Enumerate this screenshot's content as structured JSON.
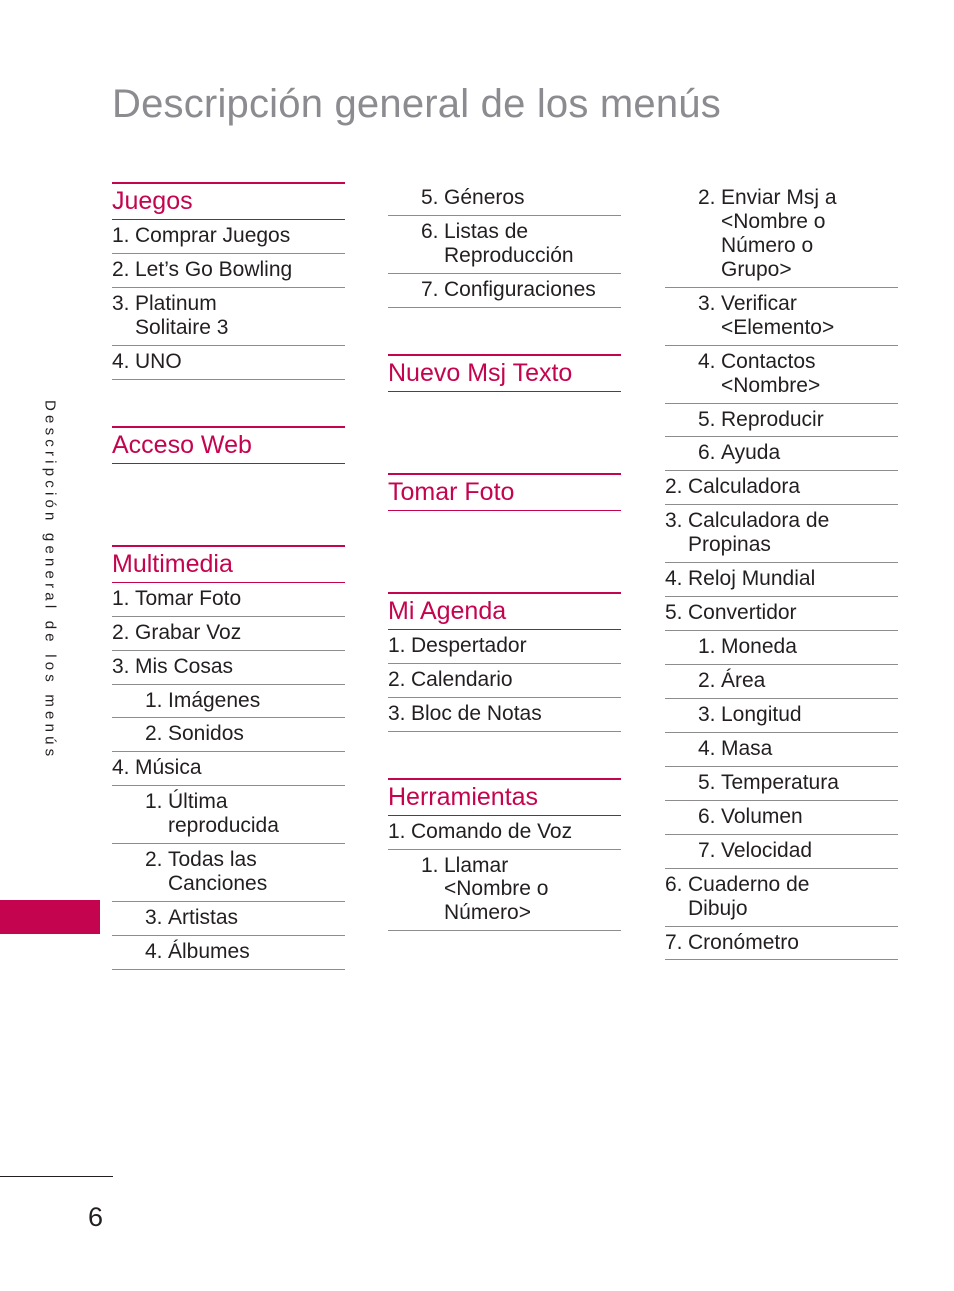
{
  "page": {
    "title": "Descripción general de los menús",
    "side_tab_text": "Descripción general de los menús",
    "page_number": "6",
    "accent_color": "#c4044f",
    "title_color": "#8b8b90",
    "rule_color": "#8d8d8d",
    "text_color": "#231f20"
  },
  "columns": [
    {
      "id": "column-1",
      "blocks": [
        {
          "type": "section",
          "heading": "Juegos",
          "items": [
            {
              "num": "1.",
              "text": "Comprar Juegos",
              "indent": false
            },
            {
              "num": "2.",
              "text": "Let’s Go Bowling",
              "indent": false
            },
            {
              "num": "3.",
              "text": "Platinum\nSolitaire 3",
              "indent": false
            },
            {
              "num": "4.",
              "text": "UNO",
              "indent": false
            }
          ]
        },
        {
          "type": "gap"
        },
        {
          "type": "section",
          "heading": "Acceso Web",
          "items": []
        },
        {
          "type": "gap"
        },
        {
          "type": "section",
          "heading": "Multimedia",
          "items": [
            {
              "num": "1.",
              "text": "Tomar Foto",
              "indent": false
            },
            {
              "num": "2.",
              "text": "Grabar Voz",
              "indent": false
            },
            {
              "num": "3.",
              "text": "Mis Cosas",
              "indent": false
            },
            {
              "num": "1.",
              "text": "Imágenes",
              "indent": true
            },
            {
              "num": "2.",
              "text": "Sonidos",
              "indent": true
            },
            {
              "num": "4.",
              "text": "Música",
              "indent": false
            },
            {
              "num": "1.",
              "text": "Última\nreproducida",
              "indent": true
            },
            {
              "num": "2.",
              "text": "Todas las\nCanciones",
              "indent": true
            },
            {
              "num": "3.",
              "text": "Artistas",
              "indent": true
            },
            {
              "num": "4.",
              "text": "Álbumes",
              "indent": true
            }
          ]
        }
      ]
    },
    {
      "id": "column-2",
      "blocks": [
        {
          "type": "loose",
          "items": [
            {
              "num": "5.",
              "text": "Géneros",
              "indent": true
            },
            {
              "num": "6.",
              "text": "Listas de\nReproducción",
              "indent": true
            },
            {
              "num": "7.",
              "text": "Configuraciones",
              "indent": true
            }
          ]
        },
        {
          "type": "gap"
        },
        {
          "type": "section",
          "heading": "Nuevo Msj Texto",
          "items": []
        },
        {
          "type": "gap"
        },
        {
          "type": "section",
          "heading": "Tomar Foto",
          "items": []
        },
        {
          "type": "gap"
        },
        {
          "type": "section",
          "heading": "Mi Agenda",
          "items": [
            {
              "num": "1.",
              "text": "Despertador",
              "indent": false
            },
            {
              "num": "2.",
              "text": "Calendario",
              "indent": false
            },
            {
              "num": "3.",
              "text": "Bloc de Notas",
              "indent": false
            }
          ]
        },
        {
          "type": "gap"
        },
        {
          "type": "section",
          "heading": "Herramientas",
          "items": [
            {
              "num": "1.",
              "text": "Comando de Voz",
              "indent": false
            },
            {
              "num": "1.",
              "text": "Llamar\n<Nombre o\nNúmero>",
              "indent": true
            }
          ]
        }
      ]
    },
    {
      "id": "column-3",
      "blocks": [
        {
          "type": "loose",
          "items": [
            {
              "num": "2.",
              "text": "Enviar Msj a\n<Nombre o\nNúmero o\nGrupo>",
              "indent": true
            },
            {
              "num": "3.",
              "text": "Verificar\n<Elemento>",
              "indent": true
            },
            {
              "num": "4.",
              "text": "Contactos\n<Nombre>",
              "indent": true
            },
            {
              "num": "5.",
              "text": "Reproducir",
              "indent": true
            },
            {
              "num": "6.",
              "text": "Ayuda",
              "indent": true
            },
            {
              "num": "2.",
              "text": "Calculadora",
              "indent": false
            },
            {
              "num": "3.",
              "text": "Calculadora de\nPropinas",
              "indent": false
            },
            {
              "num": "4.",
              "text": "Reloj Mundial",
              "indent": false
            },
            {
              "num": "5.",
              "text": "Convertidor",
              "indent": false
            },
            {
              "num": "1.",
              "text": "Moneda",
              "indent": true
            },
            {
              "num": "2.",
              "text": "Área",
              "indent": true
            },
            {
              "num": "3.",
              "text": "Longitud",
              "indent": true
            },
            {
              "num": "4.",
              "text": "Masa",
              "indent": true
            },
            {
              "num": "5.",
              "text": "Temperatura",
              "indent": true
            },
            {
              "num": "6.",
              "text": "Volumen",
              "indent": true
            },
            {
              "num": "7.",
              "text": "Velocidad",
              "indent": true
            },
            {
              "num": "6.",
              "text": "Cuaderno de\nDibujo",
              "indent": false
            },
            {
              "num": "7.",
              "text": "Cronómetro",
              "indent": false
            }
          ]
        }
      ]
    }
  ]
}
